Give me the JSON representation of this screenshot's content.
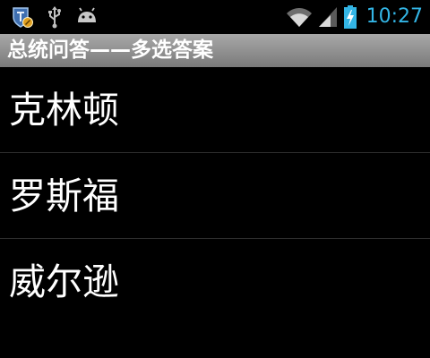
{
  "status_bar": {
    "time": "10:27",
    "icons_left": [
      "shield-app-icon",
      "usb-icon",
      "android-debug-icon"
    ],
    "icons_right": [
      "wifi-icon",
      "cell-signal-icon",
      "battery-charging-icon"
    ],
    "clock_color": "#33b5e5"
  },
  "title_bar": {
    "title": "总统问答——多选答案",
    "background": "#8f8f8f"
  },
  "answers": {
    "items": [
      {
        "label": "克林顿"
      },
      {
        "label": "罗斯福"
      },
      {
        "label": "威尔逊"
      }
    ]
  }
}
